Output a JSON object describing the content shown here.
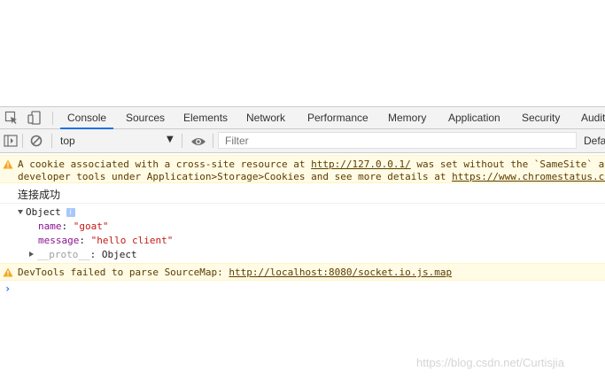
{
  "tabs": [
    "Console",
    "Sources",
    "Elements",
    "Network",
    "Performance",
    "Memory",
    "Application",
    "Security",
    "Audit"
  ],
  "active_tab": "Console",
  "toolbar": {
    "context": "top",
    "filter_placeholder": "Filter",
    "levels": "Defa"
  },
  "messages": {
    "warning1_line1_a": "A cookie associated with a cross-site resource at ",
    "warning1_link1": "http://127.0.0.1/",
    "warning1_line1_b": " was set without the `SameSite` attribu",
    "warning1_line2_a": "developer tools under Application>Storage>Cookies and see more details at ",
    "warning1_link2": "https://www.chromestatus.com",
    "log_text": "连接成功",
    "object_label": "Object",
    "object_info": "i",
    "prop_name_key": "name",
    "prop_name_value": "\"goat\"",
    "prop_message_key": "message",
    "prop_message_value": "\"hello client\"",
    "proto_key": "__proto__",
    "proto_value": "Object",
    "warning2_text": "DevTools failed to parse SourceMap: ",
    "warning2_link": "http://localhost:8080/socket.io.js.map",
    "prompt": "›"
  },
  "watermark": "https://blog.csdn.net/Curtisjia",
  "colors": {
    "accent": "#1a73e8",
    "warning_bg": "#fffbe5",
    "warning_text": "#5c3c00",
    "key": "#881391",
    "string": "#c41a16"
  }
}
